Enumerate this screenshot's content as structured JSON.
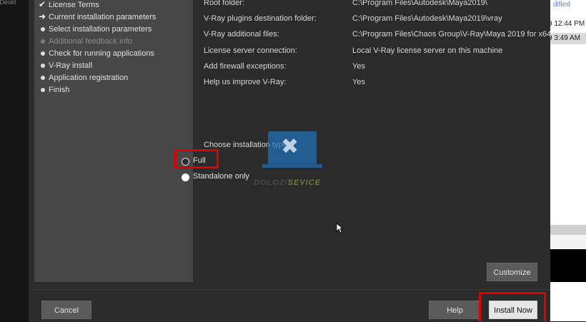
{
  "background": {
    "left_path": "r\\Deskt",
    "right_modified_header": "dified",
    "right_dates": [
      "9 12:44 PM",
      "9 3:49 AM"
    ]
  },
  "sidebar": {
    "items": [
      {
        "label": "License Terms",
        "state": "done",
        "icon": "check-icon"
      },
      {
        "label": "Current installation parameters",
        "state": "current",
        "icon": "arrow-right-icon"
      },
      {
        "label": "Select installation parameters",
        "state": "pending",
        "icon": "bullet-icon"
      },
      {
        "label": "Additional feedback info",
        "state": "disabled",
        "icon": "bullet-icon"
      },
      {
        "label": "Check for running applications",
        "state": "pending",
        "icon": "bullet-icon"
      },
      {
        "label": "V-Ray install",
        "state": "pending",
        "icon": "bullet-icon"
      },
      {
        "label": "Application registration",
        "state": "pending",
        "icon": "bullet-icon"
      },
      {
        "label": "Finish",
        "state": "pending",
        "icon": "bullet-icon"
      }
    ]
  },
  "params": [
    {
      "label": "Root folder:",
      "value": "C:\\Program Files\\Autodesk\\Maya2019\\"
    },
    {
      "label": "V-Ray plugins destination folder:",
      "value": "C:\\Program Files\\Autodesk\\Maya2019\\vray"
    },
    {
      "label": "V-Ray additional files:",
      "value": "C:\\Program Files\\Chaos Group\\V-Ray\\Maya 2019 for x64"
    },
    {
      "label": "License server connection:",
      "value": "Local V-Ray license server on this machine"
    },
    {
      "label": "Add firewall exceptions:",
      "value": "Yes"
    },
    {
      "label": "Help us improve V-Ray:",
      "value": "Yes"
    }
  ],
  "install_type": {
    "label": "Choose installation type:",
    "options": [
      {
        "label": "Full",
        "selected": false
      },
      {
        "label": "Standalone only",
        "selected": true
      }
    ]
  },
  "watermark": {
    "brand_a": "DOLOZI",
    "brand_b": "SEVICE"
  },
  "buttons": {
    "customize": "Customize",
    "cancel": "Cancel",
    "help": "Help",
    "install_now": "Install Now"
  },
  "colors": {
    "highlight": "#e00000",
    "accent": "#1f6fb8"
  }
}
